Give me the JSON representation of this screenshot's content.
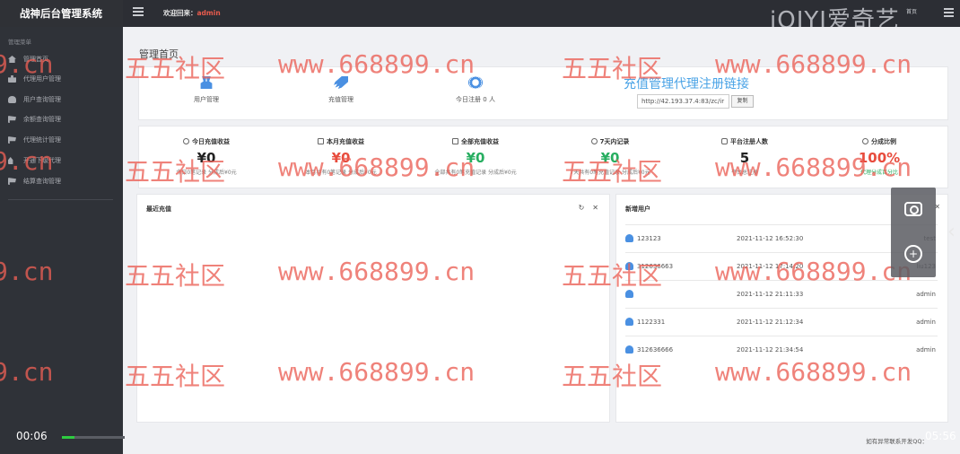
{
  "app": {
    "title": "战神后台管理系统"
  },
  "header": {
    "welcome_label": "欢迎回来：",
    "username": "admin",
    "logo_text": "iQIYI爱奇艺",
    "top_right_text": "首页"
  },
  "sidebar": {
    "section_title": "管理菜单",
    "items": [
      {
        "label": "管理首页",
        "icon": "home-icon"
      },
      {
        "label": "代理用户管理",
        "icon": "sitemap-icon"
      },
      {
        "label": "用户查询管理",
        "icon": "user-icon"
      },
      {
        "label": "余额查询管理",
        "icon": "cart-icon"
      },
      {
        "label": "代理统计管理",
        "icon": "cart-icon"
      },
      {
        "label": "开通下级代理",
        "icon": "users-icon"
      },
      {
        "label": "结算查询管理",
        "icon": "cart-icon"
      }
    ]
  },
  "main": {
    "page_title": "管理首页",
    "quick_actions": [
      {
        "label": "用户管理",
        "icon": "users-icon"
      },
      {
        "label": "充值管理",
        "icon": "rocket-icon"
      },
      {
        "label": "今日注册 0 人",
        "icon": "lifering-icon"
      }
    ],
    "register": {
      "title": "充值管理代理注册链接",
      "link_value": "http://42.193.37.4:83/zc/ir",
      "copy_label": "复制"
    },
    "stats": [
      {
        "title": "今日充值收益",
        "value": "¥0",
        "color": "#222222",
        "desc": "今日0笔记录 分成后¥0元"
      },
      {
        "title": "本月充值收益",
        "value": "¥0",
        "color": "#e84c3d",
        "desc": "本月共有0笔记录 分成后¥0元"
      },
      {
        "title": "全部充值收益",
        "value": "¥0",
        "color": "#27ae60",
        "desc": "全部共有0笔充值记录 分成后¥0元"
      },
      {
        "title": "7天内记录",
        "value": "¥0",
        "color": "#27ae60",
        "desc": "7天共有0笔充值记录 分成后¥0元"
      },
      {
        "title": "平台注册人数",
        "value": "5",
        "color": "#222222",
        "desc": "平台总注册"
      },
      {
        "title": "分成比例",
        "value": "100%",
        "color": "#e84c3d",
        "desc": "代理分成百分比"
      }
    ],
    "recent_recharge": {
      "title": "最近充值"
    },
    "new_users": {
      "title": "新增用户",
      "rows": [
        {
          "name": "123123",
          "time": "2021-11-12 16:52:30",
          "agent": "test"
        },
        {
          "name": "312636663",
          "time": "2021-11-12 17:14:20",
          "agent": "liu123"
        },
        {
          "name": "",
          "time": "2021-11-12 21:11:33",
          "agent": "admin"
        },
        {
          "name": "1122331",
          "time": "2021-11-12 21:12:34",
          "agent": "admin"
        },
        {
          "name": "312636666",
          "time": "2021-11-12 21:34:54",
          "agent": "admin"
        }
      ]
    }
  },
  "footer": {
    "text": "如有异常联系开发QQ："
  },
  "watermark": {
    "site": "www.668899.cn",
    "brand": "五五社区",
    "fragment": "9.cn"
  },
  "player": {
    "elapsed": "00:06",
    "remaining": "05:56",
    "progress": 0.2
  }
}
